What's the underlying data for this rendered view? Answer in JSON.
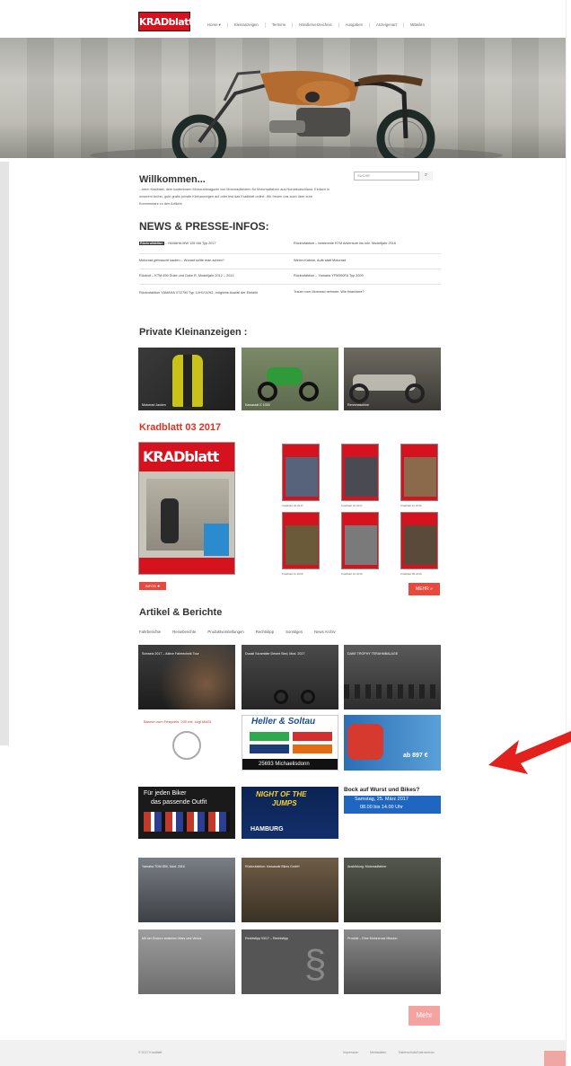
{
  "header": {
    "logo": "KRADblatt",
    "nav": [
      "Home ▾",
      "Kleinanzeigen",
      "Termine",
      "Händlerverzeichnis",
      "Ausgaben",
      "Anzeigenart",
      "Mitteilen"
    ]
  },
  "welcome": {
    "title": "Willkommen...",
    "line1": "...beim Kradblatt, dem kostenlosen Motorradmagazin von Motorradfahrern für Motorradfahrer aus Norddeutschland. Einfach in",
    "line2": "unserem Archiv, gute gratis private Kleinanzeigen auf oder lest das Kradblatt online. Wir freuen uns auch über eure",
    "line3": "Kommentare zu den Artikeln",
    "search_placeholder": "SUCHE"
  },
  "news": {
    "title": "NEWS & PRESSE-INFOS:",
    "items": [
      [
        "Rückrufaktion – YAMAHA MW 125 MA Typ 2017",
        "Rückrufaktion – bestimmte KTM Adventure bis inkl. Modelljahr 2016"
      ],
      [
        "Motorrad gebraucht kaufen – Worauf sollte man achten?",
        "Winter-Kabine, Aufe statt Motorrad"
      ],
      [
        "Rückruf – KTM 690 Duke und Duke R, Modelljahr 2012 – 2013",
        "Rückrufaktion – Yamaha YFM350FA Typ 2009"
      ],
      [
        "Rückrufaktion YAMAHA XTZ750 Typ 1VH1/1VH2, mögliche Ausfall der Elektrik",
        "Trauer vom Motorrad nehmen: Wie finanziere?"
      ]
    ]
  },
  "private": {
    "title": "Private Kleinanzeigen :",
    "tiles": [
      "Motorrad Jacken",
      "Kawasaki Z 1000",
      "Rennmaschine"
    ]
  },
  "kradblatt": {
    "title": "Kradblatt 03 2017",
    "cover_logo": "KRADblatt",
    "infos_label": "INFOS ✚",
    "more_label": "MEHR »",
    "issues": [
      "Kradblatt 02 2017",
      "Kradblatt 01 2017",
      "Kradblatt 12 2016",
      "Kradblatt 11 2016",
      "Kradblatt 10 2016",
      "Kradblatt 09 2016"
    ]
  },
  "articles": {
    "title": "Artikel & Berichte",
    "categories": [
      "Fahrberichte",
      "Reiseberichte",
      "Produktvorstellungen",
      "Rechtstipp",
      "Sonstiges",
      "News Archiv"
    ],
    "row1": [
      "Schweiz 2017 – Aktive Fahrtechnik Tour",
      "Ducati Scrambler Desert Sled, Mod. 2017",
      "DAKE TROPHY TERAHMBALAGE"
    ],
    "ads": {
      "ad1": "Banner zum Festpreis: 200 mit. zzgl MwSt.",
      "ad2_name": "Heller & Soltau",
      "ad2_city": "25693 Michaelisdonn",
      "ad3_price": "ab 897 €",
      "ad4_line1": "Für jeden Biker",
      "ad4_line2": "das passende Outfit",
      "ad5_line1": "NIGHT OF THE",
      "ad5_line2": "JUMPS",
      "ad5_city": "HAMBURG",
      "ad6_title": "Bock auf Wurst und Bikes?",
      "ad6_date": "Samstag, 25. März 2017",
      "ad6_time": "08.00 bis 14.00 Uhr"
    },
    "row2": [
      "Yamaha TDM 850, Mod. 2016",
      "Rückrufaktion: Kawasaki Bikes GmbH",
      "Ausbildung: Motorradfahrer"
    ],
    "row3": [
      "Mit der Enduro zwischen Mars und Venus",
      "Rechtstipp 03/17 – Rechtstipp",
      "Produkt – Eine Motorcross Mission"
    ],
    "more_label": "Mehr"
  },
  "footer": {
    "copyright": "© 2017 Kradblatt",
    "links": [
      "Impressum",
      "Mediadaten",
      "Datenschutz/Datenschutz"
    ]
  },
  "colors": {
    "accent": "#e8493c",
    "logo_red": "#d5121d"
  }
}
